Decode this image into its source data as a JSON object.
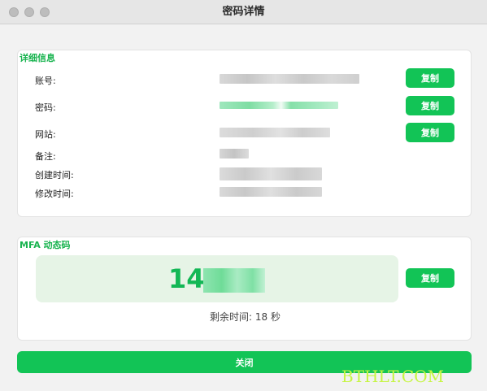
{
  "window": {
    "title": "密码详情"
  },
  "details": {
    "section_title": "详细信息",
    "fields": [
      {
        "label": "账号:"
      },
      {
        "label": "密码:"
      },
      {
        "label": "网站:"
      },
      {
        "label": "备注:"
      },
      {
        "label": "创建时间:"
      },
      {
        "label": "修改时间:"
      }
    ],
    "copy_label": "复制"
  },
  "mfa": {
    "section_title": "MFA 动态码",
    "code_visible": "14",
    "copy_label": "复制",
    "remaining_prefix": "剩余时间:",
    "remaining_value": "18",
    "remaining_unit": "秒"
  },
  "footer": {
    "close_label": "关闭"
  },
  "watermark": "BTHLT.COM",
  "colors": {
    "accent": "#12c456",
    "section_title": "#17b34e",
    "mfa_bg": "#e6f4e6"
  }
}
